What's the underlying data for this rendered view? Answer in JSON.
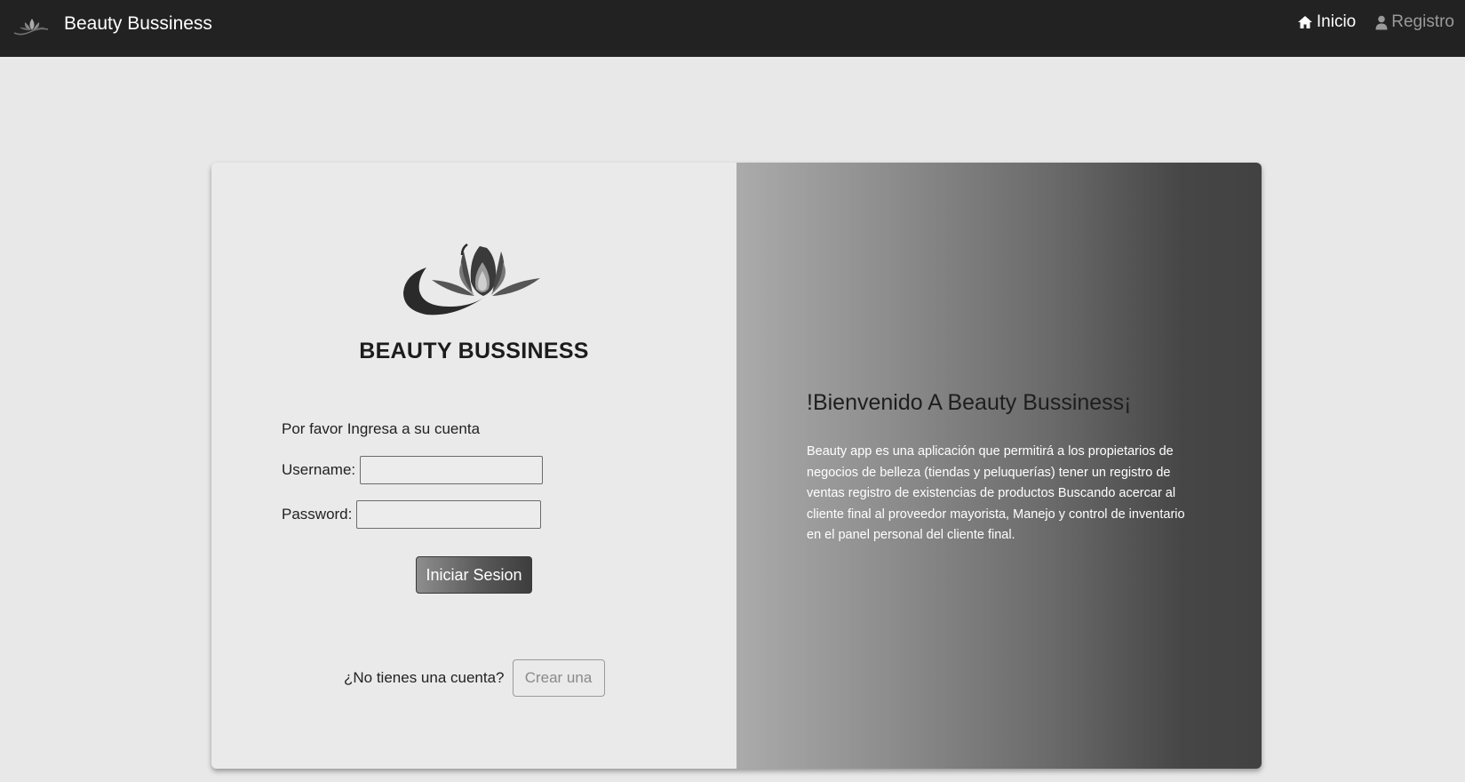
{
  "header": {
    "brand": "Beauty Bussiness",
    "nav": [
      {
        "label": "Inicio",
        "icon": "home-icon"
      },
      {
        "label": "Registro",
        "icon": "user-icon"
      }
    ]
  },
  "login": {
    "title": "BEAUTY BUSSINESS",
    "prompt": "Por favor Ingresa a su cuenta",
    "username_label": "Username:",
    "username_value": "",
    "password_label": "Password:",
    "password_value": "",
    "submit_label": "Iniciar Sesion",
    "signup_text": "¿No tienes una cuenta?",
    "signup_button": "Crear una"
  },
  "welcome": {
    "title": "!Bienvenido A Beauty Bussiness¡",
    "body": "Beauty app es una aplicación que permitirá a los propietarios de negocios de belleza (tiendas y peluquerías) tener un registro de ventas registro de existencias de productos Buscando acercar al cliente final al proveedor mayorista, Manejo y control de inventario en el panel personal del cliente final."
  },
  "colors": {
    "navbar": "#222222",
    "page_background": "#e8e8e8",
    "gradient_start": "#ababab",
    "gradient_end": "#424242"
  }
}
